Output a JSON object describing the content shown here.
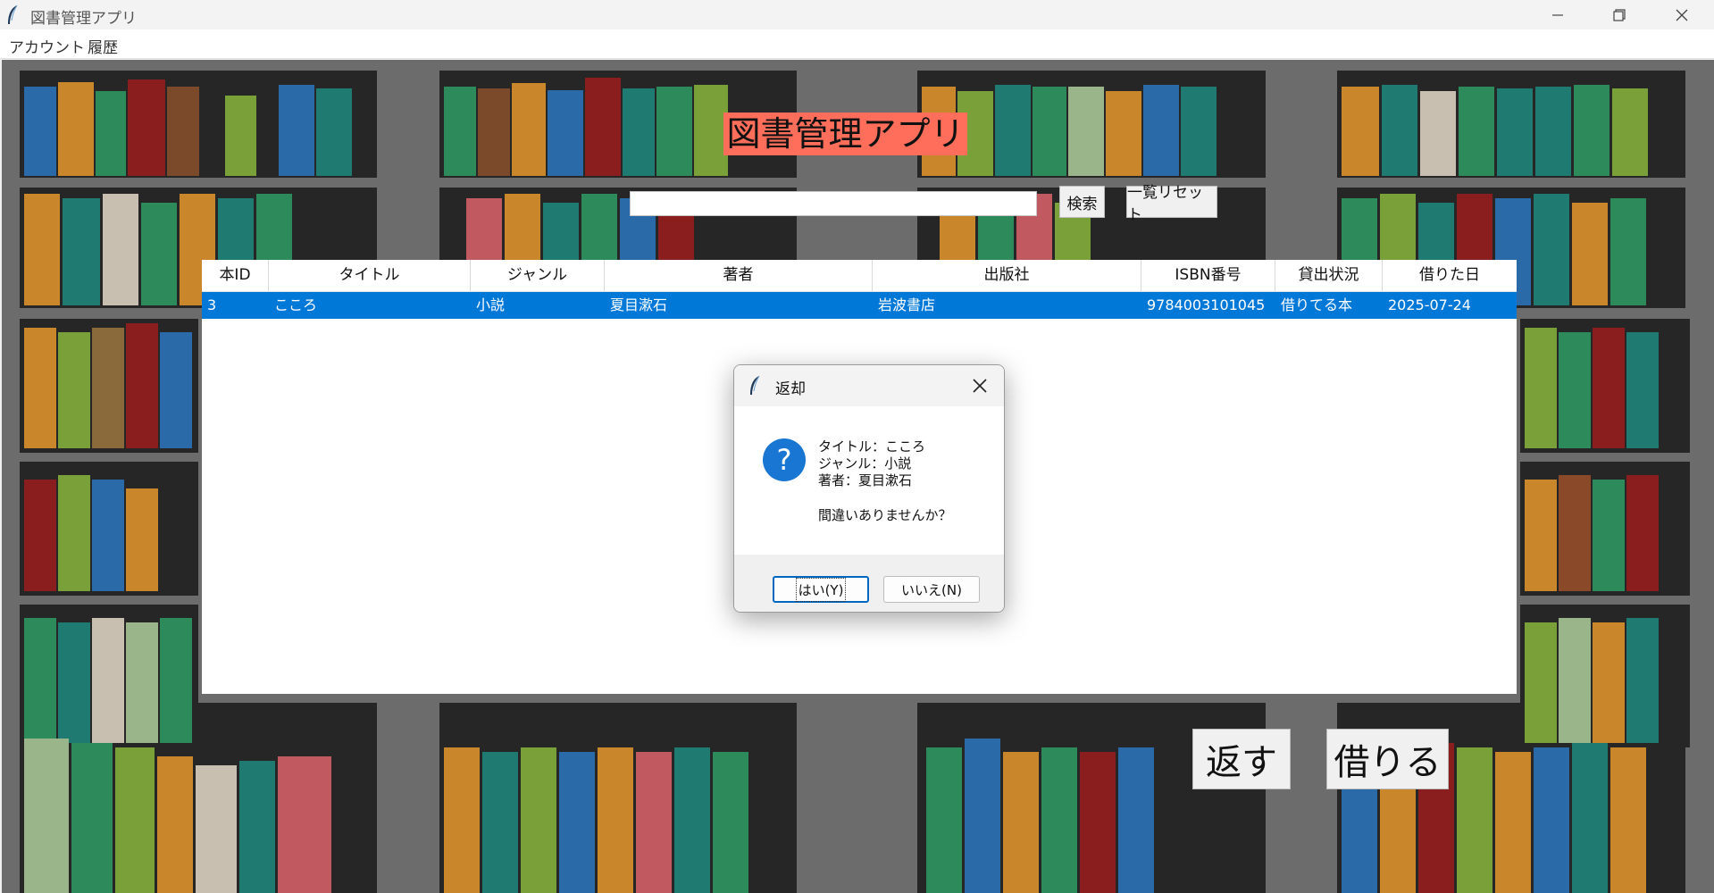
{
  "window": {
    "title": "図書管理アプリ",
    "controls": [
      "minimize-icon",
      "restore-icon",
      "close-icon"
    ]
  },
  "menubar": {
    "items": [
      {
        "label": "アカウント"
      },
      {
        "label": "履歴"
      }
    ]
  },
  "app": {
    "title": "図書管理アプリ",
    "title_bg": "#ff6e5a",
    "search": {
      "value": "",
      "placeholder": ""
    },
    "search_button": "検索",
    "reset_button": "一覧リセット"
  },
  "table": {
    "columns": [
      "本ID",
      "タイトル",
      "ジャンル",
      "著者",
      "出版社",
      "ISBN番号",
      "貸出状況",
      "借りた日"
    ],
    "rows": [
      {
        "id": "3",
        "title": "こころ",
        "genre": "小説",
        "author": "夏目漱石",
        "publisher": "岩波書店",
        "isbn": "9784003101045",
        "status": "借りてる本",
        "date": "2025-07-24",
        "selected": true
      }
    ],
    "selection_color": "#0078d7"
  },
  "dialog": {
    "title": "返却",
    "icon": "question-icon",
    "lines": [
      "タイトル：こころ",
      "ジャンル：小説",
      "著者：夏目漱石"
    ],
    "question": "間違いありませんか？",
    "yes_button": "はい(Y)",
    "no_button": "いいえ(N)"
  },
  "actions": {
    "return_button": "返す",
    "borrow_button": "借りる"
  }
}
